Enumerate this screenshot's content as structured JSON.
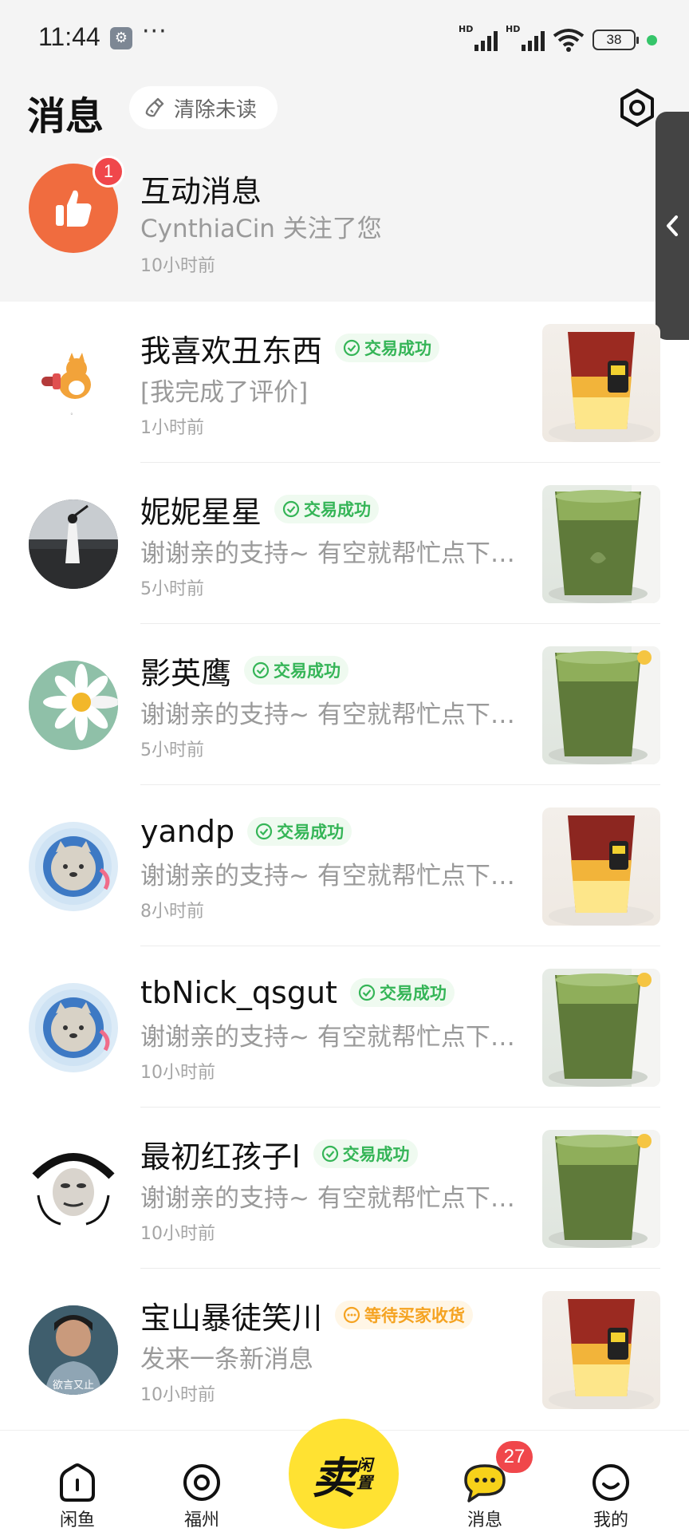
{
  "status_bar": {
    "time": "11:44",
    "dots": "···",
    "battery": "38",
    "network_left": "HD",
    "network_right": "HD"
  },
  "header": {
    "title": "消息",
    "clear_unread": "清除未读"
  },
  "interaction": {
    "title": "互动消息",
    "badge": "1",
    "subtitle": "CynthiaCin 关注了您",
    "time": "10小时前"
  },
  "conversations": [
    {
      "name": "我喜欢丑东西",
      "tag": "交易成功",
      "tag_type": "ok",
      "preview": "[我完成了评价]",
      "time": "1小时前",
      "product": "red-tea"
    },
    {
      "name": "妮妮星星",
      "tag": "交易成功",
      "tag_type": "ok",
      "preview": "谢谢亲的支持~ 有空就帮忙点下…",
      "time": "5小时前",
      "product": "green-tea"
    },
    {
      "name": "影英鹰",
      "tag": "交易成功",
      "tag_type": "ok",
      "preview": "谢谢亲的支持~ 有空就帮忙点下…",
      "time": "5小时前",
      "product": "green-tea"
    },
    {
      "name": "yandp",
      "tag": "交易成功",
      "tag_type": "ok",
      "preview": "谢谢亲的支持~ 有空就帮忙点下…",
      "time": "8小时前",
      "product": "red-tea"
    },
    {
      "name": "tbNick_qsgut",
      "tag": "交易成功",
      "tag_type": "ok",
      "preview": "谢谢亲的支持~ 有空就帮忙点下…",
      "time": "10小时前",
      "product": "green-tea"
    },
    {
      "name": "最初红孩子l",
      "tag": "交易成功",
      "tag_type": "ok",
      "preview": "谢谢亲的支持~ 有空就帮忙点下…",
      "time": "10小时前",
      "product": "green-tea"
    },
    {
      "name": "宝山暴徒笑川",
      "tag": "等待买家收货",
      "tag_type": "wait",
      "preview": "发来一条新消息",
      "time": "10小时前",
      "product": "red-tea"
    }
  ],
  "avatar_captions": {
    "row7": "欲言又止"
  },
  "tabbar": {
    "home": "闲鱼",
    "local": "福州",
    "sell_main": "卖",
    "sell_sub": "闲置",
    "messages": "消息",
    "messages_badge": "27",
    "me": "我的"
  },
  "colors": {
    "accent_yellow": "#ffe232",
    "badge_red": "#f0474b",
    "success_green": "#35b557",
    "waiting_orange": "#f5a321",
    "like_orange": "#f06c3f"
  },
  "icons": [
    "wrench-icon",
    "signal-icon",
    "wifi-icon",
    "battery-icon",
    "broom-icon",
    "settings-icon",
    "thumbs-up-icon",
    "chevron-left-icon",
    "check-circle-icon",
    "pending-icon",
    "home-icon",
    "location-icon",
    "chat-icon",
    "smile-icon"
  ]
}
